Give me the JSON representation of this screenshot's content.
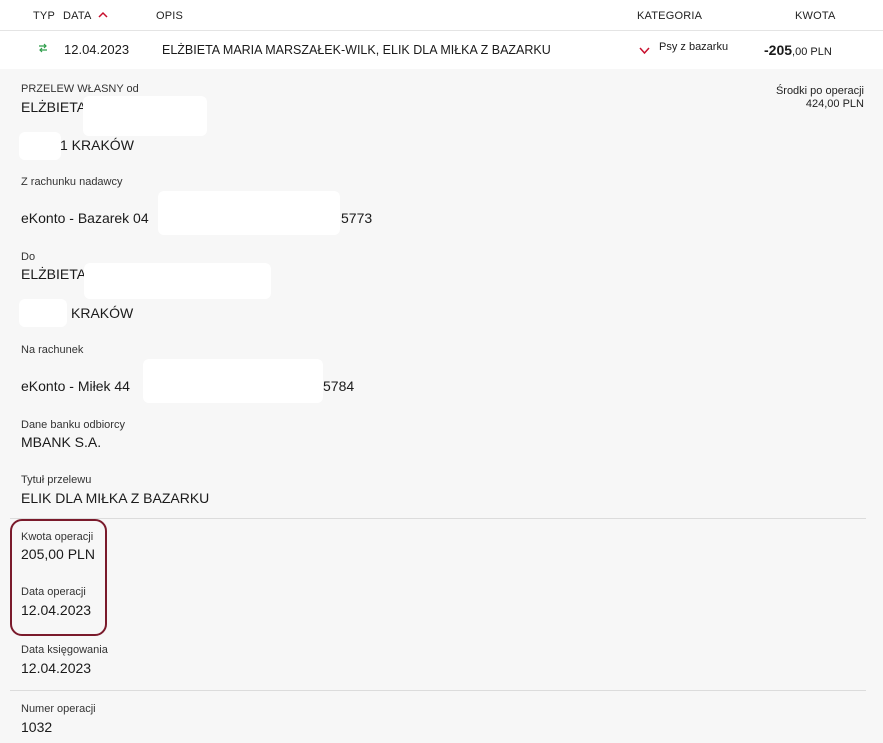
{
  "header": {
    "typ": "TYP",
    "data": "DATA",
    "opis": "OPIS",
    "kategoria": "KATEGORIA",
    "kwota": "KWOTA"
  },
  "transaction": {
    "date": "12.04.2023",
    "description": "ELŻBIETA MARIA MARSZAŁEK-WILK, ELIK DLA MIŁKA Z BAZARKU",
    "category": "Psy z bazarku",
    "amount_int": "-205",
    "amount_dec": ",00 PLN"
  },
  "details": {
    "type_label": "PRZELEW WŁASNY od",
    "sender_name": "ELŻBIETA",
    "sender_city": "1 KRAKÓW",
    "balance_label": "Środki po operacji",
    "balance_value": "424,00 PLN",
    "from_account_label": "Z rachunku nadawcy",
    "from_account_prefix": "eKonto - Bazarek 04",
    "from_account_suffix": "5773",
    "to_label": "Do",
    "recipient_name": "ELŻBIETA",
    "recipient_city": "KRAKÓW",
    "to_account_label": "Na rachunek",
    "to_account_prefix": "eKonto - Miłek 44",
    "to_account_suffix": "5784",
    "bank_label": "Dane banku odbiorcy",
    "bank_value": "MBANK S.A.",
    "title_label": "Tytuł przelewu",
    "title_value": "ELIK DLA MIŁKA Z BAZARKU",
    "amount_label": "Kwota operacji",
    "amount_value": "205,00 PLN",
    "op_date_label": "Data operacji",
    "op_date_value": "12.04.2023",
    "book_date_label": "Data księgowania",
    "book_date_value": "12.04.2023",
    "op_number_label": "Numer operacji",
    "op_number_value": "1032"
  },
  "colors": {
    "accent_red": "#c8102e",
    "highlight_border": "#7a1a2b",
    "transfer_icon": "#2e9e4a"
  },
  "icons": {
    "type_icon": "transfer-arrows-icon",
    "sort_icon": "chevron-up-icon",
    "category_icon": "chevron-down-icon"
  }
}
